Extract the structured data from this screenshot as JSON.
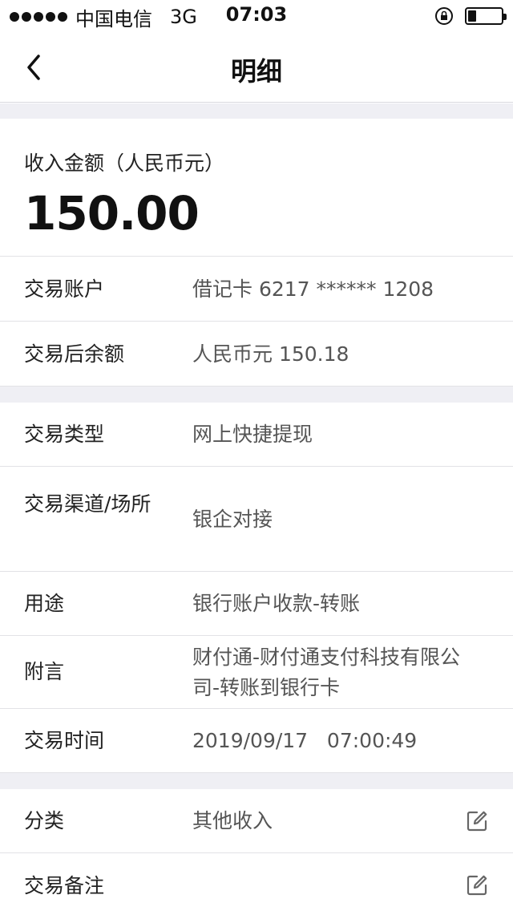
{
  "status_bar": {
    "carrier": "中国电信",
    "network": "3G",
    "time": "07:03"
  },
  "nav": {
    "title": "明细"
  },
  "amount": {
    "label": "收入金额（人民币元）",
    "value": "150.00"
  },
  "account": {
    "rows": [
      {
        "key": "交易账户",
        "value": "借记卡 6217 ****** 1208"
      },
      {
        "key": "交易后余额",
        "value": "人民币元 150.18"
      }
    ]
  },
  "details": {
    "rows": [
      {
        "key": "交易类型",
        "value": "网上快捷提现"
      },
      {
        "key": "交易渠道/场所",
        "value": "银企对接"
      },
      {
        "key": "用途",
        "value": "银行账户收款-转账"
      },
      {
        "key": "附言",
        "value": "财付通-财付通支付科技有限公司-转账到银行卡"
      },
      {
        "key": "交易时间",
        "value": "2019/09/17   07:00:49"
      }
    ]
  },
  "extra": {
    "rows": [
      {
        "key": "分类",
        "value": "其他收入",
        "icon": "edit-icon"
      },
      {
        "key": "交易备注",
        "value": "",
        "icon": "edit-icon"
      }
    ]
  }
}
